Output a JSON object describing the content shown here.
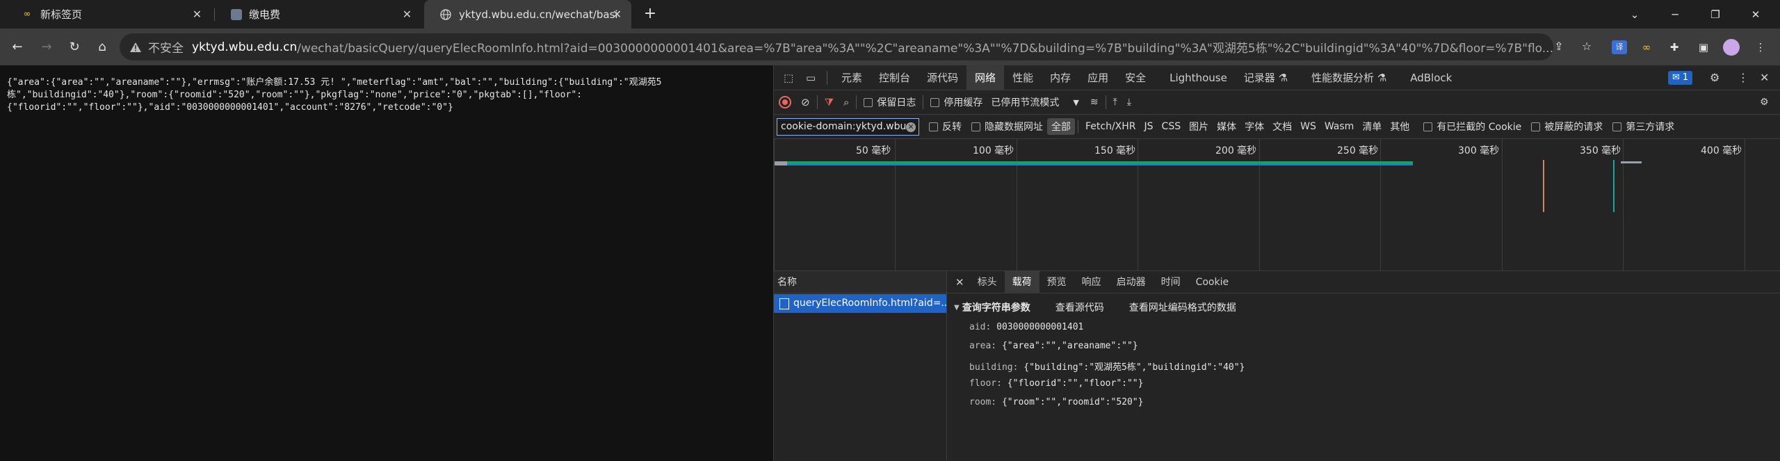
{
  "tabs": [
    {
      "title": "新标签页",
      "icon": "infinity-icon"
    },
    {
      "title": "缴电费",
      "icon": "image-icon"
    },
    {
      "title": "yktyd.wbu.edu.cn/wechat/basi",
      "icon": "globe-icon",
      "active": true
    }
  ],
  "address": {
    "insecure_label": "不安全",
    "host": "yktyd.wbu.edu.cn",
    "path": "/wechat/basicQuery/queryElecRoomInfo.html?aid=0030000000001401&area=%7B\"area\"%3A\"\"%2C\"areaname\"%3A\"\"%7D&building=%7B\"building\"%3A\"观湖苑5栋\"%2C\"buildingid\"%3A\"40\"%7D&floor=%7B\"flo..."
  },
  "page": {
    "json_text": "{\"area\":{\"area\":\"\",\"areaname\":\"\"},\"errmsg\":\"账户余额:17.53 元! \",\"meterflag\":\"amt\",\"bal\":\"\",\"building\":{\"building\":\"观湖苑5\n栋\",\"buildingid\":\"40\"},\"room\":{\"roomid\":\"520\",\"room\":\"\"},\"pkgflag\":\"none\",\"price\":\"0\",\"pkgtab\":[],\"floor\":\n{\"floorid\":\"\",\"floor\":\"\"},\"aid\":\"0030000000001401\",\"account\":\"8276\",\"retcode\":\"0\"}"
  },
  "devtools": {
    "tabs": [
      "元素",
      "控制台",
      "源代码",
      "网络",
      "性能",
      "内存",
      "应用",
      "安全",
      "Lighthouse",
      "记录器 ⚗",
      "性能数据分析 ⚗",
      "AdBlock"
    ],
    "active_tab": "网络",
    "issues_count": "1",
    "preserve_log": "保留日志",
    "disable_cache": "停用缓存",
    "throttle": "已停用节流模式",
    "filter_value": "cookie-domain:yktyd.wbu.e",
    "invert": "反转",
    "hide_data_urls": "隐藏数据网址",
    "types": [
      "全部",
      "Fetch/XHR",
      "JS",
      "CSS",
      "图片",
      "媒体",
      "字体",
      "文档",
      "WS",
      "Wasm",
      "清单",
      "其他"
    ],
    "blocked_cookies": "有已拦截的 Cookie",
    "blocked_requests": "被屏蔽的请求",
    "third_party": "第三方请求",
    "timeline_ticks": [
      "50 毫秒",
      "100 毫秒",
      "150 毫秒",
      "200 毫秒",
      "250 毫秒",
      "300 毫秒",
      "350 毫秒",
      "400 毫秒"
    ],
    "name_header": "名称",
    "request_name": "queryElecRoomInfo.html?aid=...",
    "detail_tabs": [
      "标头",
      "载荷",
      "预览",
      "响应",
      "启动器",
      "时间",
      "Cookie"
    ],
    "active_detail": "载荷",
    "query_header": "查询字符串参数",
    "view_source": "查看源代码",
    "view_encoded": "查看网址编码格式的数据",
    "params": [
      {
        "key": "aid:",
        "value": "0030000000001401"
      },
      {
        "key": "area:",
        "value": "{\"area\":\"\",\"areaname\":\"\"}"
      },
      {
        "key": "building:",
        "value": "{\"building\":\"观湖苑5栋\",\"buildingid\":\"40\"}"
      },
      {
        "key": "floor:",
        "value": "{\"floorid\":\"\",\"floor\":\"\"}"
      },
      {
        "key": "room:",
        "value": "{\"room\":\"\",\"roomid\":\"520\"}"
      }
    ]
  },
  "colors": {
    "accent": "#8ab4f8",
    "selected_row": "#1f63c4",
    "record": "#e46962"
  }
}
